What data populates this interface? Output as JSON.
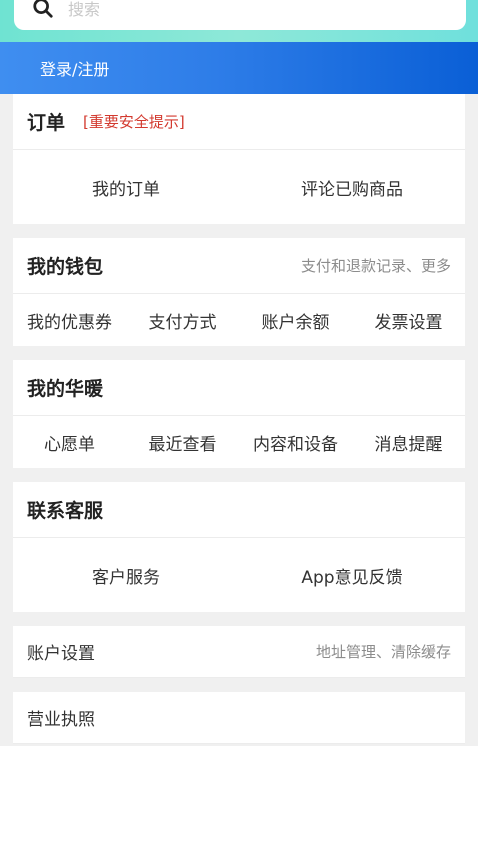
{
  "search": {
    "placeholder": "搜索",
    "icon": "search-icon"
  },
  "login": {
    "label": "登录/注册"
  },
  "orders": {
    "title": "订单",
    "warning": "[重要安全提示]",
    "items": [
      "我的订单",
      "评论已购商品"
    ]
  },
  "wallet": {
    "title": "我的钱包",
    "hint": "支付和退款记录、更多",
    "items": [
      "我的优惠券",
      "支付方式",
      "账户余额",
      "发票设置"
    ]
  },
  "huanuan": {
    "title": "我的华暖",
    "items": [
      "心愿单",
      "最近查看",
      "内容和设备",
      "消息提醒"
    ]
  },
  "service": {
    "title": "联系客服",
    "items": [
      "客户服务",
      "App意见反馈"
    ]
  },
  "account": {
    "label": "账户设置",
    "hint": "地址管理、清除缓存"
  },
  "license": {
    "label": "营业执照"
  },
  "colors": {
    "top_gradient": "#6fe3d2",
    "login_blue": "#2e7de8",
    "warning_red": "#d33a2f"
  }
}
